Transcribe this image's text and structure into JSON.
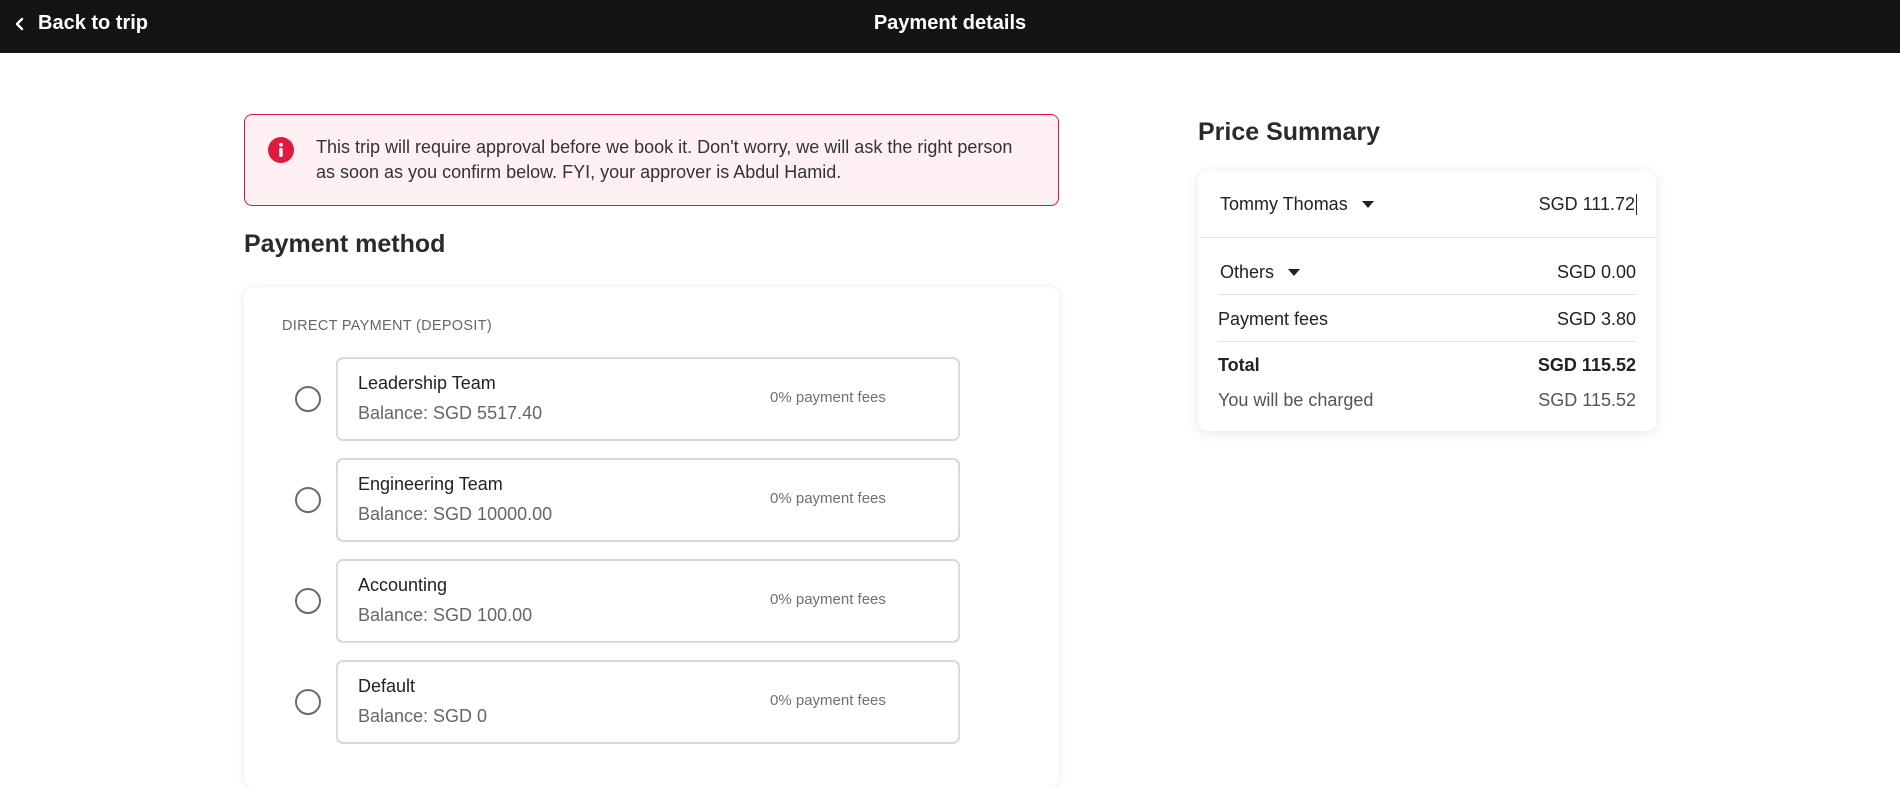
{
  "header": {
    "back_label": "Back to trip",
    "title": "Payment details"
  },
  "alert": {
    "icon": "info-icon",
    "message": "This trip will require approval before we book it. Don't worry, we will ask the right person as soon as you confirm below. FYI, your approver is Abdul Hamid."
  },
  "payment_method": {
    "title": "Payment method",
    "group_label": "DIRECT PAYMENT (DEPOSIT)",
    "options": [
      {
        "name": "Leadership Team",
        "balance": "Balance: SGD 5517.40",
        "fees": "0% payment fees"
      },
      {
        "name": "Engineering Team",
        "balance": "Balance: SGD 10000.00",
        "fees": "0% payment fees"
      },
      {
        "name": "Accounting",
        "balance": "Balance: SGD 100.00",
        "fees": "0% payment fees"
      },
      {
        "name": "Default",
        "balance": "Balance: SGD 0",
        "fees": "0% payment fees"
      }
    ]
  },
  "price_summary": {
    "title": "Price Summary",
    "traveller": {
      "name": "Tommy Thomas",
      "amount": "SGD 111.72"
    },
    "others": {
      "label": "Others",
      "amount": "SGD 0.00"
    },
    "payment_fees": {
      "label": "Payment fees",
      "amount": "SGD 3.80"
    },
    "total": {
      "label": "Total",
      "amount": "SGD 115.52"
    },
    "charged": {
      "label": "You will be charged",
      "amount": "SGD 115.52"
    }
  },
  "colors": {
    "topbar": "#141414",
    "alert_border": "#d6173f",
    "alert_background": "#fff1f3",
    "alert_icon": "#e0193f"
  }
}
